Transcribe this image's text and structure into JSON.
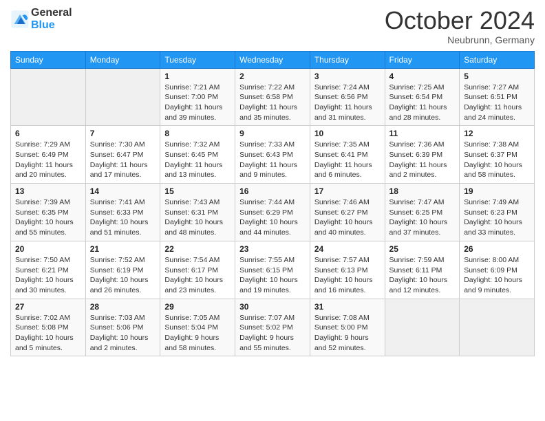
{
  "header": {
    "logo_line1": "General",
    "logo_line2": "Blue",
    "month_title": "October 2024",
    "location": "Neubrunn, Germany"
  },
  "weekdays": [
    "Sunday",
    "Monday",
    "Tuesday",
    "Wednesday",
    "Thursday",
    "Friday",
    "Saturday"
  ],
  "weeks": [
    [
      {
        "day": "",
        "info": ""
      },
      {
        "day": "",
        "info": ""
      },
      {
        "day": "1",
        "info": "Sunrise: 7:21 AM\nSunset: 7:00 PM\nDaylight: 11 hours and 39 minutes."
      },
      {
        "day": "2",
        "info": "Sunrise: 7:22 AM\nSunset: 6:58 PM\nDaylight: 11 hours and 35 minutes."
      },
      {
        "day": "3",
        "info": "Sunrise: 7:24 AM\nSunset: 6:56 PM\nDaylight: 11 hours and 31 minutes."
      },
      {
        "day": "4",
        "info": "Sunrise: 7:25 AM\nSunset: 6:54 PM\nDaylight: 11 hours and 28 minutes."
      },
      {
        "day": "5",
        "info": "Sunrise: 7:27 AM\nSunset: 6:51 PM\nDaylight: 11 hours and 24 minutes."
      }
    ],
    [
      {
        "day": "6",
        "info": "Sunrise: 7:29 AM\nSunset: 6:49 PM\nDaylight: 11 hours and 20 minutes."
      },
      {
        "day": "7",
        "info": "Sunrise: 7:30 AM\nSunset: 6:47 PM\nDaylight: 11 hours and 17 minutes."
      },
      {
        "day": "8",
        "info": "Sunrise: 7:32 AM\nSunset: 6:45 PM\nDaylight: 11 hours and 13 minutes."
      },
      {
        "day": "9",
        "info": "Sunrise: 7:33 AM\nSunset: 6:43 PM\nDaylight: 11 hours and 9 minutes."
      },
      {
        "day": "10",
        "info": "Sunrise: 7:35 AM\nSunset: 6:41 PM\nDaylight: 11 hours and 6 minutes."
      },
      {
        "day": "11",
        "info": "Sunrise: 7:36 AM\nSunset: 6:39 PM\nDaylight: 11 hours and 2 minutes."
      },
      {
        "day": "12",
        "info": "Sunrise: 7:38 AM\nSunset: 6:37 PM\nDaylight: 10 hours and 58 minutes."
      }
    ],
    [
      {
        "day": "13",
        "info": "Sunrise: 7:39 AM\nSunset: 6:35 PM\nDaylight: 10 hours and 55 minutes."
      },
      {
        "day": "14",
        "info": "Sunrise: 7:41 AM\nSunset: 6:33 PM\nDaylight: 10 hours and 51 minutes."
      },
      {
        "day": "15",
        "info": "Sunrise: 7:43 AM\nSunset: 6:31 PM\nDaylight: 10 hours and 48 minutes."
      },
      {
        "day": "16",
        "info": "Sunrise: 7:44 AM\nSunset: 6:29 PM\nDaylight: 10 hours and 44 minutes."
      },
      {
        "day": "17",
        "info": "Sunrise: 7:46 AM\nSunset: 6:27 PM\nDaylight: 10 hours and 40 minutes."
      },
      {
        "day": "18",
        "info": "Sunrise: 7:47 AM\nSunset: 6:25 PM\nDaylight: 10 hours and 37 minutes."
      },
      {
        "day": "19",
        "info": "Sunrise: 7:49 AM\nSunset: 6:23 PM\nDaylight: 10 hours and 33 minutes."
      }
    ],
    [
      {
        "day": "20",
        "info": "Sunrise: 7:50 AM\nSunset: 6:21 PM\nDaylight: 10 hours and 30 minutes."
      },
      {
        "day": "21",
        "info": "Sunrise: 7:52 AM\nSunset: 6:19 PM\nDaylight: 10 hours and 26 minutes."
      },
      {
        "day": "22",
        "info": "Sunrise: 7:54 AM\nSunset: 6:17 PM\nDaylight: 10 hours and 23 minutes."
      },
      {
        "day": "23",
        "info": "Sunrise: 7:55 AM\nSunset: 6:15 PM\nDaylight: 10 hours and 19 minutes."
      },
      {
        "day": "24",
        "info": "Sunrise: 7:57 AM\nSunset: 6:13 PM\nDaylight: 10 hours and 16 minutes."
      },
      {
        "day": "25",
        "info": "Sunrise: 7:59 AM\nSunset: 6:11 PM\nDaylight: 10 hours and 12 minutes."
      },
      {
        "day": "26",
        "info": "Sunrise: 8:00 AM\nSunset: 6:09 PM\nDaylight: 10 hours and 9 minutes."
      }
    ],
    [
      {
        "day": "27",
        "info": "Sunrise: 7:02 AM\nSunset: 5:08 PM\nDaylight: 10 hours and 5 minutes."
      },
      {
        "day": "28",
        "info": "Sunrise: 7:03 AM\nSunset: 5:06 PM\nDaylight: 10 hours and 2 minutes."
      },
      {
        "day": "29",
        "info": "Sunrise: 7:05 AM\nSunset: 5:04 PM\nDaylight: 9 hours and 58 minutes."
      },
      {
        "day": "30",
        "info": "Sunrise: 7:07 AM\nSunset: 5:02 PM\nDaylight: 9 hours and 55 minutes."
      },
      {
        "day": "31",
        "info": "Sunrise: 7:08 AM\nSunset: 5:00 PM\nDaylight: 9 hours and 52 minutes."
      },
      {
        "day": "",
        "info": ""
      },
      {
        "day": "",
        "info": ""
      }
    ]
  ]
}
